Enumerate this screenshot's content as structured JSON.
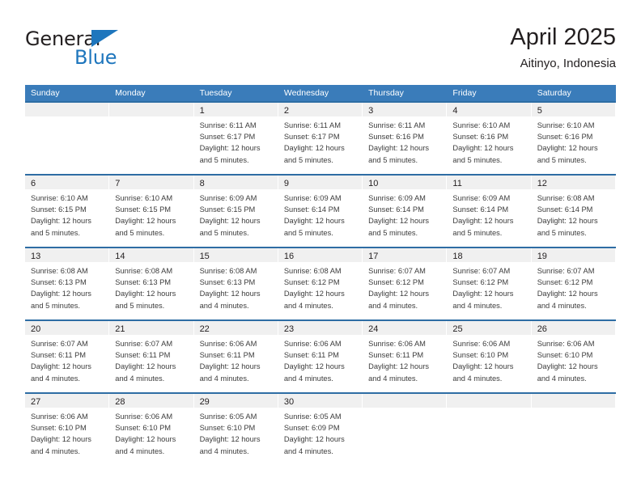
{
  "brand": {
    "name_top": "General",
    "name_bottom": "Blue",
    "triangle_color": "#1e76bd",
    "text_color": "#231f20"
  },
  "header": {
    "title": "April 2025",
    "subtitle": "Aitinyo, Indonesia"
  },
  "theme": {
    "header_blue": "#3a7cba",
    "row_divider_blue": "#2e6da4",
    "daynum_band_gray": "#f0f0f0",
    "text_color": "#3c3c3c"
  },
  "weekdays": [
    "Sunday",
    "Monday",
    "Tuesday",
    "Wednesday",
    "Thursday",
    "Friday",
    "Saturday"
  ],
  "labels": {
    "sunrise_prefix": "Sunrise:",
    "sunset_prefix": "Sunset:",
    "daylight_prefix": "Daylight:"
  },
  "weeks": [
    [
      {
        "day": "",
        "line1": "",
        "line2": "",
        "line3": "",
        "line4": ""
      },
      {
        "day": "",
        "line1": "",
        "line2": "",
        "line3": "",
        "line4": ""
      },
      {
        "day": "1",
        "line1": "Sunrise: 6:11 AM",
        "line2": "Sunset: 6:17 PM",
        "line3": "Daylight: 12 hours",
        "line4": "and 5 minutes."
      },
      {
        "day": "2",
        "line1": "Sunrise: 6:11 AM",
        "line2": "Sunset: 6:17 PM",
        "line3": "Daylight: 12 hours",
        "line4": "and 5 minutes."
      },
      {
        "day": "3",
        "line1": "Sunrise: 6:11 AM",
        "line2": "Sunset: 6:16 PM",
        "line3": "Daylight: 12 hours",
        "line4": "and 5 minutes."
      },
      {
        "day": "4",
        "line1": "Sunrise: 6:10 AM",
        "line2": "Sunset: 6:16 PM",
        "line3": "Daylight: 12 hours",
        "line4": "and 5 minutes."
      },
      {
        "day": "5",
        "line1": "Sunrise: 6:10 AM",
        "line2": "Sunset: 6:16 PM",
        "line3": "Daylight: 12 hours",
        "line4": "and 5 minutes."
      }
    ],
    [
      {
        "day": "6",
        "line1": "Sunrise: 6:10 AM",
        "line2": "Sunset: 6:15 PM",
        "line3": "Daylight: 12 hours",
        "line4": "and 5 minutes."
      },
      {
        "day": "7",
        "line1": "Sunrise: 6:10 AM",
        "line2": "Sunset: 6:15 PM",
        "line3": "Daylight: 12 hours",
        "line4": "and 5 minutes."
      },
      {
        "day": "8",
        "line1": "Sunrise: 6:09 AM",
        "line2": "Sunset: 6:15 PM",
        "line3": "Daylight: 12 hours",
        "line4": "and 5 minutes."
      },
      {
        "day": "9",
        "line1": "Sunrise: 6:09 AM",
        "line2": "Sunset: 6:14 PM",
        "line3": "Daylight: 12 hours",
        "line4": "and 5 minutes."
      },
      {
        "day": "10",
        "line1": "Sunrise: 6:09 AM",
        "line2": "Sunset: 6:14 PM",
        "line3": "Daylight: 12 hours",
        "line4": "and 5 minutes."
      },
      {
        "day": "11",
        "line1": "Sunrise: 6:09 AM",
        "line2": "Sunset: 6:14 PM",
        "line3": "Daylight: 12 hours",
        "line4": "and 5 minutes."
      },
      {
        "day": "12",
        "line1": "Sunrise: 6:08 AM",
        "line2": "Sunset: 6:14 PM",
        "line3": "Daylight: 12 hours",
        "line4": "and 5 minutes."
      }
    ],
    [
      {
        "day": "13",
        "line1": "Sunrise: 6:08 AM",
        "line2": "Sunset: 6:13 PM",
        "line3": "Daylight: 12 hours",
        "line4": "and 5 minutes."
      },
      {
        "day": "14",
        "line1": "Sunrise: 6:08 AM",
        "line2": "Sunset: 6:13 PM",
        "line3": "Daylight: 12 hours",
        "line4": "and 5 minutes."
      },
      {
        "day": "15",
        "line1": "Sunrise: 6:08 AM",
        "line2": "Sunset: 6:13 PM",
        "line3": "Daylight: 12 hours",
        "line4": "and 4 minutes."
      },
      {
        "day": "16",
        "line1": "Sunrise: 6:08 AM",
        "line2": "Sunset: 6:12 PM",
        "line3": "Daylight: 12 hours",
        "line4": "and 4 minutes."
      },
      {
        "day": "17",
        "line1": "Sunrise: 6:07 AM",
        "line2": "Sunset: 6:12 PM",
        "line3": "Daylight: 12 hours",
        "line4": "and 4 minutes."
      },
      {
        "day": "18",
        "line1": "Sunrise: 6:07 AM",
        "line2": "Sunset: 6:12 PM",
        "line3": "Daylight: 12 hours",
        "line4": "and 4 minutes."
      },
      {
        "day": "19",
        "line1": "Sunrise: 6:07 AM",
        "line2": "Sunset: 6:12 PM",
        "line3": "Daylight: 12 hours",
        "line4": "and 4 minutes."
      }
    ],
    [
      {
        "day": "20",
        "line1": "Sunrise: 6:07 AM",
        "line2": "Sunset: 6:11 PM",
        "line3": "Daylight: 12 hours",
        "line4": "and 4 minutes."
      },
      {
        "day": "21",
        "line1": "Sunrise: 6:07 AM",
        "line2": "Sunset: 6:11 PM",
        "line3": "Daylight: 12 hours",
        "line4": "and 4 minutes."
      },
      {
        "day": "22",
        "line1": "Sunrise: 6:06 AM",
        "line2": "Sunset: 6:11 PM",
        "line3": "Daylight: 12 hours",
        "line4": "and 4 minutes."
      },
      {
        "day": "23",
        "line1": "Sunrise: 6:06 AM",
        "line2": "Sunset: 6:11 PM",
        "line3": "Daylight: 12 hours",
        "line4": "and 4 minutes."
      },
      {
        "day": "24",
        "line1": "Sunrise: 6:06 AM",
        "line2": "Sunset: 6:11 PM",
        "line3": "Daylight: 12 hours",
        "line4": "and 4 minutes."
      },
      {
        "day": "25",
        "line1": "Sunrise: 6:06 AM",
        "line2": "Sunset: 6:10 PM",
        "line3": "Daylight: 12 hours",
        "line4": "and 4 minutes."
      },
      {
        "day": "26",
        "line1": "Sunrise: 6:06 AM",
        "line2": "Sunset: 6:10 PM",
        "line3": "Daylight: 12 hours",
        "line4": "and 4 minutes."
      }
    ],
    [
      {
        "day": "27",
        "line1": "Sunrise: 6:06 AM",
        "line2": "Sunset: 6:10 PM",
        "line3": "Daylight: 12 hours",
        "line4": "and 4 minutes."
      },
      {
        "day": "28",
        "line1": "Sunrise: 6:06 AM",
        "line2": "Sunset: 6:10 PM",
        "line3": "Daylight: 12 hours",
        "line4": "and 4 minutes."
      },
      {
        "day": "29",
        "line1": "Sunrise: 6:05 AM",
        "line2": "Sunset: 6:10 PM",
        "line3": "Daylight: 12 hours",
        "line4": "and 4 minutes."
      },
      {
        "day": "30",
        "line1": "Sunrise: 6:05 AM",
        "line2": "Sunset: 6:09 PM",
        "line3": "Daylight: 12 hours",
        "line4": "and 4 minutes."
      },
      {
        "day": "",
        "line1": "",
        "line2": "",
        "line3": "",
        "line4": ""
      },
      {
        "day": "",
        "line1": "",
        "line2": "",
        "line3": "",
        "line4": ""
      },
      {
        "day": "",
        "line1": "",
        "line2": "",
        "line3": "",
        "line4": ""
      }
    ]
  ]
}
